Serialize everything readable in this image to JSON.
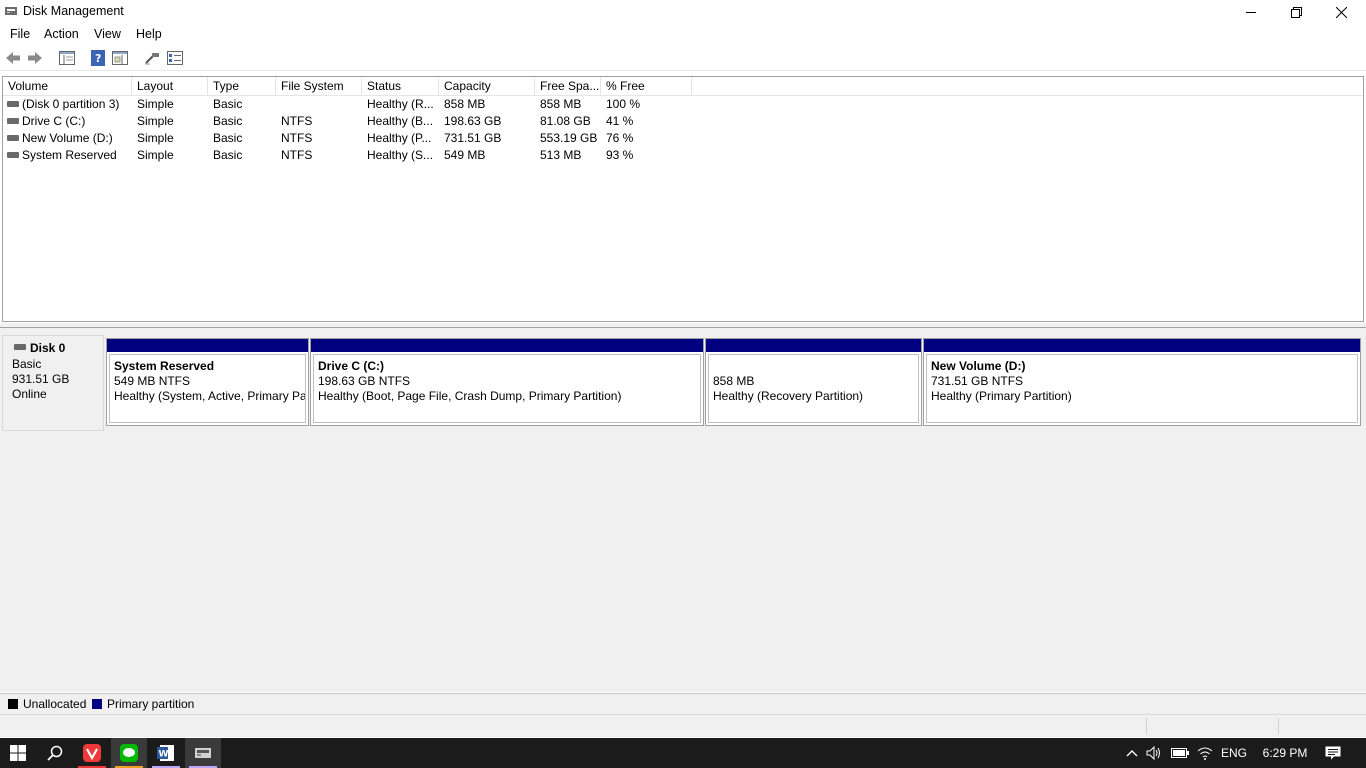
{
  "window": {
    "title": "Disk Management"
  },
  "menu": [
    "File",
    "Action",
    "View",
    "Help"
  ],
  "volume_list": {
    "columns": [
      "Volume",
      "Layout",
      "Type",
      "File System",
      "Status",
      "Capacity",
      "Free Spa...",
      "% Free"
    ],
    "rows": [
      [
        "(Disk 0 partition 3)",
        "Simple",
        "Basic",
        "",
        "Healthy (R...",
        "858 MB",
        "858 MB",
        "100 %"
      ],
      [
        "Drive C (C:)",
        "Simple",
        "Basic",
        "NTFS",
        "Healthy (B...",
        "198.63 GB",
        "81.08 GB",
        "41 %"
      ],
      [
        "New Volume (D:)",
        "Simple",
        "Basic",
        "NTFS",
        "Healthy (P...",
        "731.51 GB",
        "553.19 GB",
        "76 %"
      ],
      [
        "System Reserved",
        "Simple",
        "Basic",
        "NTFS",
        "Healthy (S...",
        "549 MB",
        "513 MB",
        "93 %"
      ]
    ]
  },
  "disk": {
    "name": "Disk 0",
    "type": "Basic",
    "size": "931.51 GB",
    "status": "Online"
  },
  "partitions": [
    {
      "name": "System Reserved",
      "size": "549 MB NTFS",
      "status": "Healthy (System, Active, Primary Pa"
    },
    {
      "name": "Drive C  (C:)",
      "size": "198.63 GB NTFS",
      "status": "Healthy (Boot, Page File, Crash Dump, Primary Partition)"
    },
    {
      "name": "",
      "size": "858 MB",
      "status": "Healthy (Recovery Partition)"
    },
    {
      "name": "New Volume  (D:)",
      "size": "731.51 GB NTFS",
      "status": "Healthy (Primary Partition)"
    }
  ],
  "legend": {
    "unallocated": "Unallocated",
    "primary": "Primary partition",
    "unallocated_color": "#000000",
    "primary_color": "#000080"
  },
  "taskbar": {
    "apps": [
      "windows-start",
      "search",
      "vivaldi",
      "line",
      "word",
      "disk-management"
    ],
    "language": "ENG",
    "time": "6:29 PM"
  }
}
